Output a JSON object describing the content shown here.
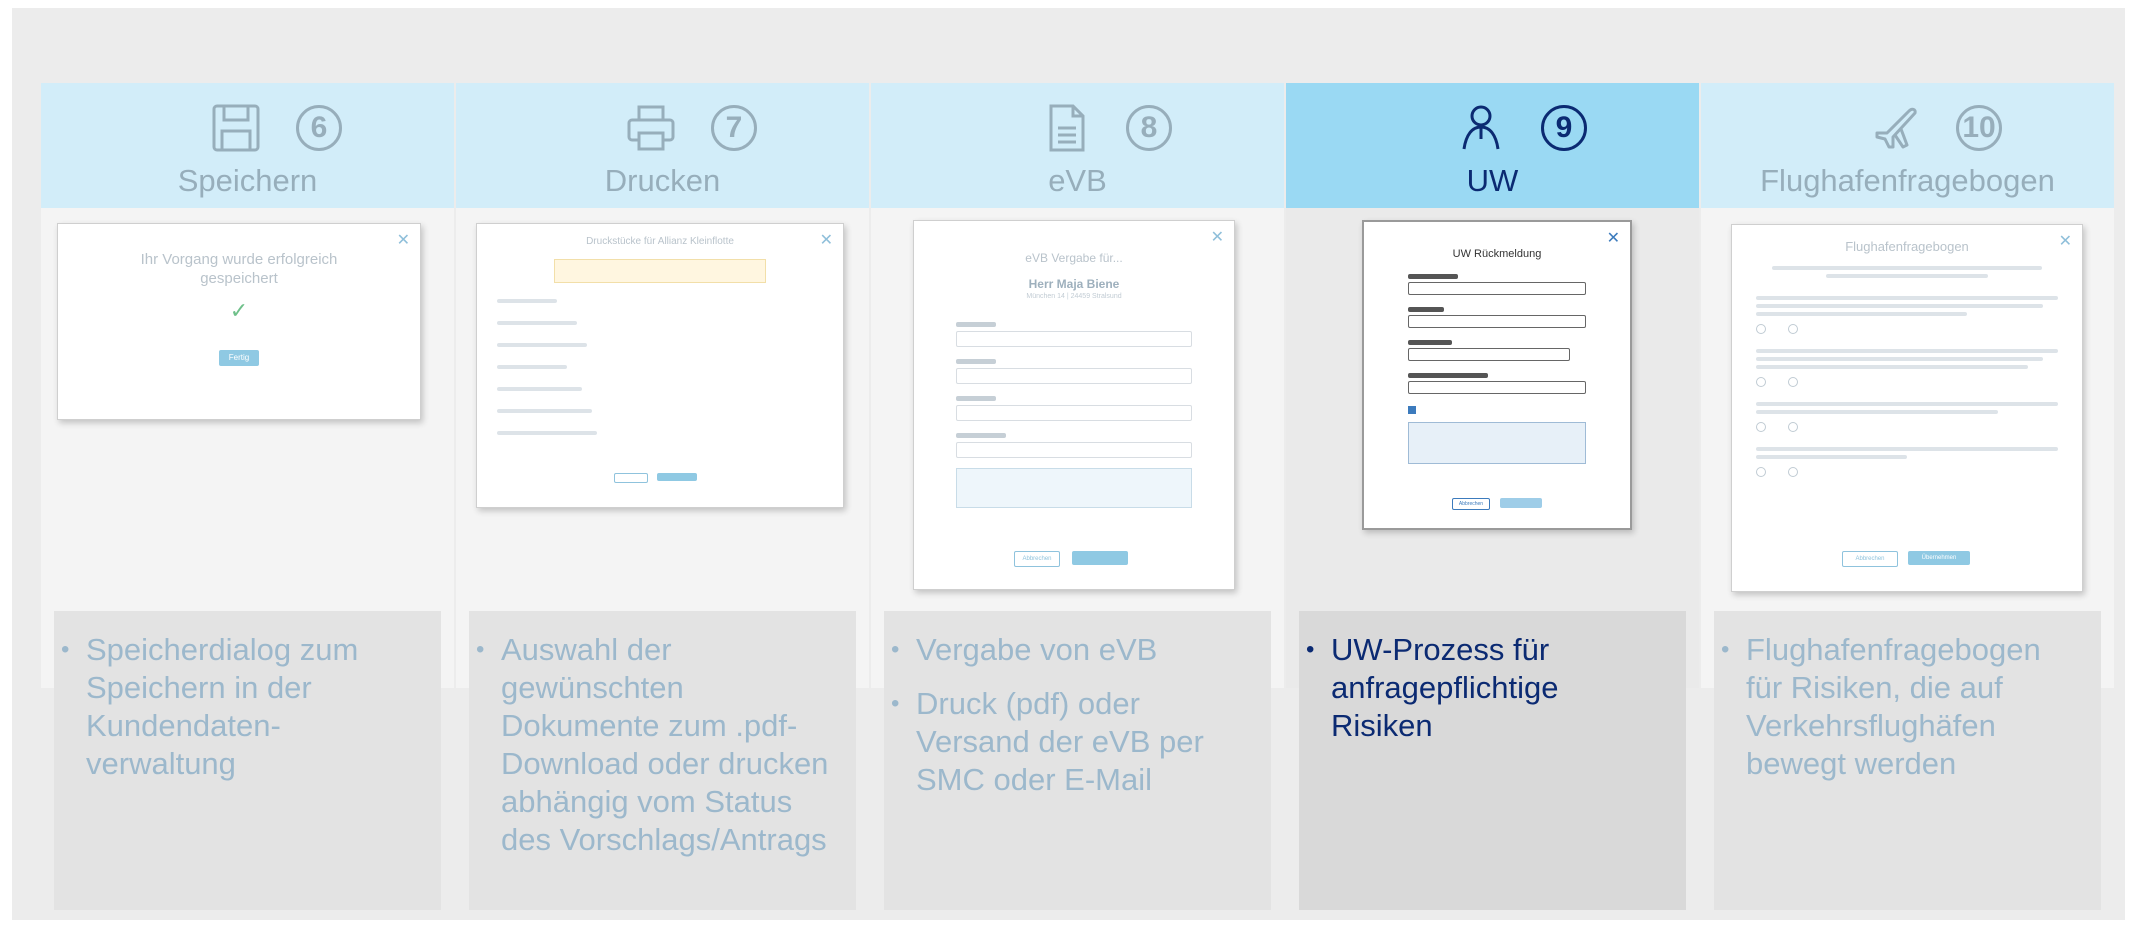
{
  "columns": [
    {
      "number": "6",
      "title": "Speichern",
      "icon": "save-icon",
      "bullets": [
        "Speicherdialog zum Speichern in der Kundendaten-verwaltung"
      ],
      "dialog": {
        "text": "Ihr Vorgang wurde erfolgreich gespeichert",
        "button": "Fertig"
      }
    },
    {
      "number": "7",
      "title": "Drucken",
      "icon": "printer-icon",
      "bullets": [
        "Auswahl der gewünschten Dokumente zum .pdf-Download oder drucken abhängig vom Status des Vorschlags/Antrags"
      ],
      "dialog": {
        "title": "Druckstücke für Allianz Kleinflotte"
      }
    },
    {
      "number": "8",
      "title": "eVB",
      "icon": "document-icon",
      "bullets": [
        "Vergabe von eVB",
        "Druck (pdf) oder Versand der eVB per SMC oder E-Mail"
      ],
      "dialog": {
        "title": "eVB Vergabe für...",
        "name": "Herr Maja Biene",
        "address": "München 14 | 24459 Stralsund",
        "button_cancel": "Abbrechen"
      }
    },
    {
      "number": "9",
      "title": "UW",
      "icon": "person-icon",
      "active": true,
      "bullets": [
        "UW-Prozess für anfragepflichtige Risiken"
      ],
      "dialog": {
        "title": "UW Rückmeldung",
        "button_cancel": "Abbrechen"
      }
    },
    {
      "number": "10",
      "title": "Flughafenfragebogen",
      "icon": "airplane-icon",
      "bullets": [
        "Flughafenfragebogen für Risiken, die auf Verkehrsflughäfen bewegt werden"
      ],
      "dialog": {
        "title": "Flughafenfragebogen",
        "button_cancel": "Abbrechen",
        "button_ok": "Übernehmen"
      }
    }
  ],
  "colors": {
    "header": "#d2edf9",
    "header_active": "#9ad9f3",
    "muted_text": "#97aebb",
    "active_text": "#0b2a72"
  }
}
